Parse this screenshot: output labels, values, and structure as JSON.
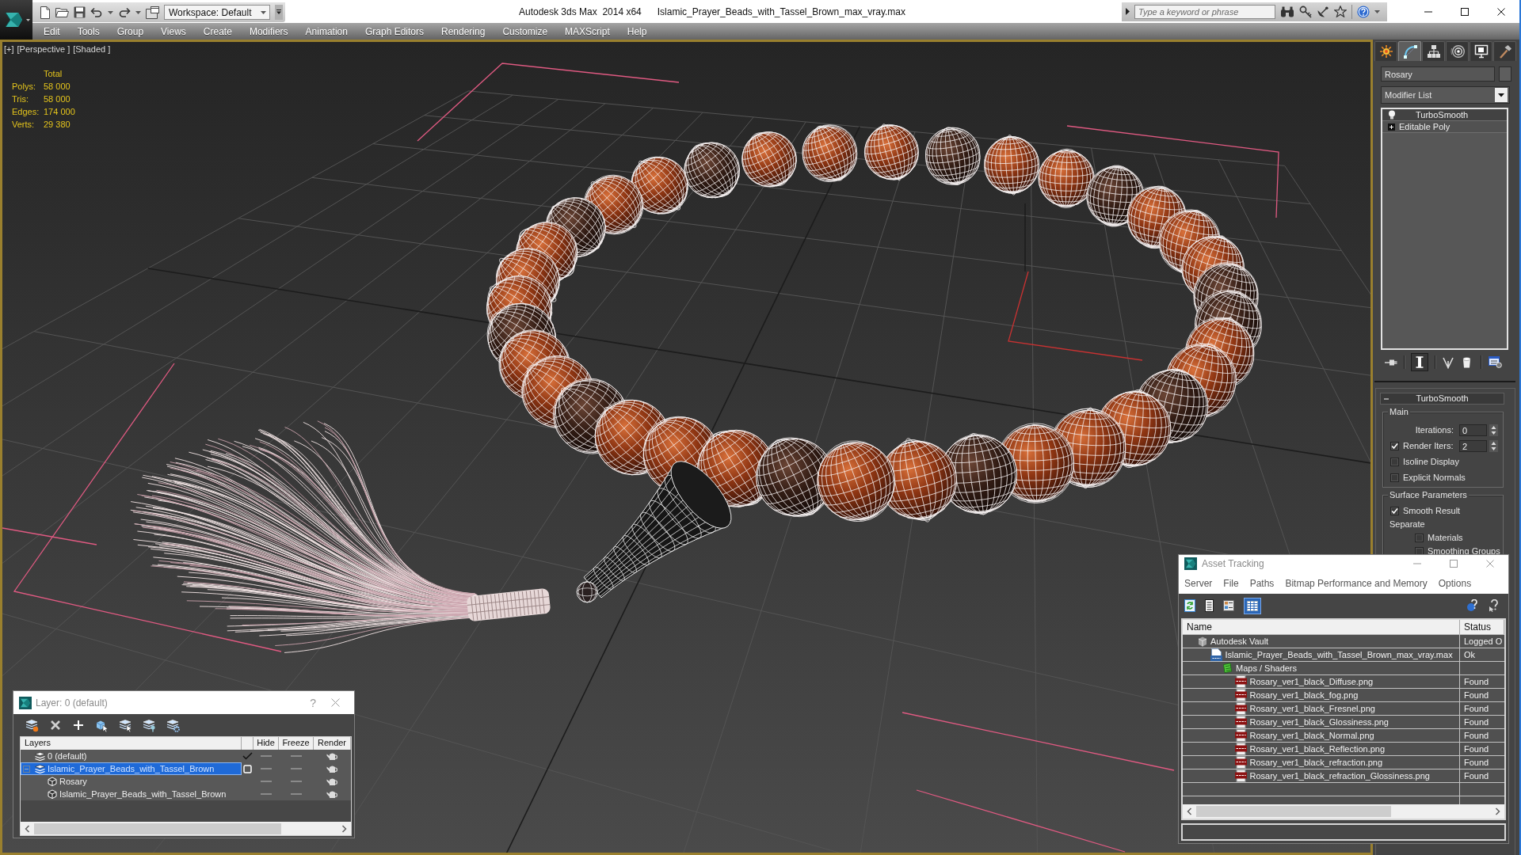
{
  "title_bar": {
    "app_title": "Autodesk 3ds Max  2014 x64",
    "file_name": "Islamic_Prayer_Beads_with_Tassel_Brown_max_vray.max",
    "workspace": "Workspace: Default",
    "search": {
      "placeholder": "Type a keyword or phrase"
    }
  },
  "menu": [
    "Edit",
    "Tools",
    "Group",
    "Views",
    "Create",
    "Modifiers",
    "Animation",
    "Graph Editors",
    "Rendering",
    "Customize",
    "MAXScript",
    "Help"
  ],
  "viewport": {
    "labels": [
      "[+]",
      "[Perspective ]",
      "[Shaded ]"
    ],
    "stats": {
      "header": "Total",
      "rows": [
        {
          "label": "Polys:",
          "value": "58 000"
        },
        {
          "label": "Tris:",
          "value": "58 000"
        },
        {
          "label": "Edges:",
          "value": "174 000"
        },
        {
          "label": "Verts:",
          "value": "29 380"
        }
      ]
    }
  },
  "command_panel": {
    "tabs": [
      {
        "kind": "create",
        "selected": false
      },
      {
        "kind": "modify",
        "selected": true
      },
      {
        "kind": "hierarchy",
        "selected": false
      },
      {
        "kind": "motion",
        "selected": false
      },
      {
        "kind": "display",
        "selected": false
      },
      {
        "kind": "utilities",
        "selected": false
      }
    ],
    "object_name": "Rosary",
    "modifier_list": "Modifier List",
    "stack": [
      {
        "kind": "modifier",
        "label": "TurboSmooth",
        "selected": true
      },
      {
        "kind": "object",
        "label": "Editable Poly",
        "selected": false
      }
    ],
    "rollout": {
      "title": "TurboSmooth",
      "expanded": true,
      "groups": [
        {
          "title": "Main",
          "controls": [
            {
              "kind": "spinner",
              "label": "Iterations:",
              "value": "0"
            },
            {
              "kind": "check_spinner",
              "label": "Render Iters:",
              "value": "2",
              "checked": true
            },
            {
              "kind": "checkbox",
              "label": "Isoline Display",
              "checked": false
            },
            {
              "kind": "checkbox",
              "label": "Explicit Normals",
              "checked": false
            }
          ]
        },
        {
          "title": "Surface Parameters",
          "controls": [
            {
              "kind": "checkbox",
              "label": "Smooth Result",
              "checked": true
            },
            {
              "kind": "caption",
              "label": "Separate"
            },
            {
              "kind": "sub_checkbox",
              "label": "Materials",
              "checked": false
            },
            {
              "kind": "sub_checkbox",
              "label": "Smoothing Groups",
              "checked": false
            }
          ]
        }
      ]
    }
  },
  "asset_tracking": {
    "title": "Asset Tracking",
    "menu": [
      "Server",
      "File",
      "Paths",
      "Bitmap Performance and Memory",
      "Options"
    ],
    "toolbar": [
      {
        "kind": "refresh",
        "selected": false
      },
      {
        "kind": "list",
        "selected": false
      },
      {
        "kind": "thumbnails",
        "selected": false
      },
      {
        "kind": "table",
        "selected": true
      }
    ],
    "columns": [
      "Name",
      "Status"
    ],
    "tree": [
      {
        "kind": "vault",
        "name": "Autodesk Vault",
        "status": "Logged O",
        "children": [
          {
            "kind": "max_file",
            "name": "Islamic_Prayer_Beads_with_Tassel_Brown_max_vray.max",
            "status": "Ok",
            "children": [
              {
                "kind": "folder",
                "name": "Maps / Shaders",
                "children": [
                  {
                    "kind": "png",
                    "name": "Rosary_ver1_black_Diffuse.png",
                    "status": "Found"
                  },
                  {
                    "kind": "png",
                    "name": "Rosary_ver1_black_fog.png",
                    "status": "Found"
                  },
                  {
                    "kind": "png",
                    "name": "Rosary_ver1_black_Fresnel.png",
                    "status": "Found"
                  },
                  {
                    "kind": "png",
                    "name": "Rosary_ver1_black_Glossiness.png",
                    "status": "Found"
                  },
                  {
                    "kind": "png",
                    "name": "Rosary_ver1_black_Normal.png",
                    "status": "Found"
                  },
                  {
                    "kind": "png",
                    "name": "Rosary_ver1_black_Reflection.png",
                    "status": "Found"
                  },
                  {
                    "kind": "png",
                    "name": "Rosary_ver1_black_refraction.png",
                    "status": "Found"
                  },
                  {
                    "kind": "png",
                    "name": "Rosary_ver1_black_refraction_Glossiness.png",
                    "status": "Found"
                  }
                ]
              }
            ]
          }
        ]
      }
    ]
  },
  "layer_dialog": {
    "title": "Layer: 0 (default)",
    "help_label": "?",
    "columns": [
      "Layers",
      "Hide",
      "Freeze",
      "Render"
    ],
    "rows": [
      {
        "kind": "layer",
        "name": "0 (default)",
        "selected": false,
        "current": true,
        "hidden": false,
        "frozen": false,
        "renderable": true
      },
      {
        "kind": "layer",
        "name": "Islamic_Prayer_Beads_with_Tassel_Brown",
        "selected": true,
        "current": false,
        "expanded": true,
        "hidden": false,
        "frozen": false,
        "renderable": true,
        "children": [
          {
            "kind": "object",
            "name": "Rosary",
            "selected": false,
            "hidden": false,
            "frozen": false,
            "renderable": true
          },
          {
            "kind": "object",
            "name": "Islamic_Prayer_Beads_with_Tassel_Brown",
            "selected": false,
            "hidden": false,
            "frozen": false,
            "renderable": true
          }
        ]
      }
    ]
  }
}
